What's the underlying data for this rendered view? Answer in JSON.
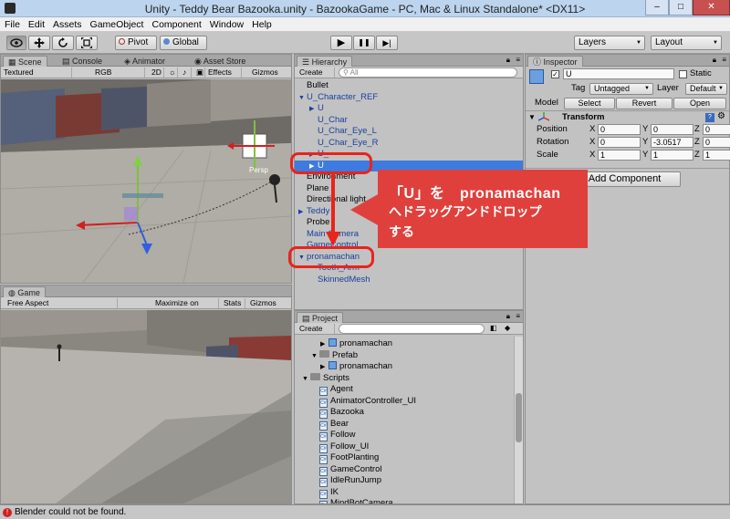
{
  "window": {
    "title": "Unity - Teddy Bear Bazooka.unity - BazookaGame - PC, Mac & Linux Standalone* <DX11>",
    "minimize": "–",
    "maximize": "□",
    "close": "✕"
  },
  "menu": [
    "File",
    "Edit",
    "Assets",
    "GameObject",
    "Component",
    "Window",
    "Help"
  ],
  "toolbar": {
    "pivot": "Pivot",
    "global": "Global",
    "layers": "Layers",
    "layout": "Layout",
    "play": "▶",
    "pause": "❚❚",
    "step": "▶|"
  },
  "scene": {
    "tabs": [
      "Scene",
      "Console",
      "Animator",
      "Asset Store"
    ],
    "strip": {
      "shading": "Textured",
      "render": "RGB",
      "mode2d": "2D",
      "effects": "Effects",
      "gizmos": "Gizmos",
      "search": "All"
    },
    "persp_label": "Persp"
  },
  "game": {
    "tab": "Game",
    "aspect": "Free Aspect",
    "maximize": "Maximize on Play",
    "stats": "Stats",
    "gizmos": "Gizmos"
  },
  "hierarchy": {
    "tab": "Hierarchy",
    "create": "Create",
    "search": "All",
    "items": [
      {
        "label": "Bullet",
        "indent": 0,
        "arrow": "",
        "color": "black"
      },
      {
        "label": "U_Character_REF",
        "indent": 0,
        "arrow": "▼",
        "color": "blue"
      },
      {
        "label": "U",
        "indent": 1,
        "arrow": "▶",
        "color": "blue"
      },
      {
        "label": "U_Char",
        "indent": 1,
        "arrow": "",
        "color": "blue"
      },
      {
        "label": "U_Char_Eye_L",
        "indent": 1,
        "arrow": "",
        "color": "blue"
      },
      {
        "label": "U_Char_Eye_R",
        "indent": 1,
        "arrow": "",
        "color": "blue"
      },
      {
        "label": "U_",
        "indent": 1,
        "arrow": "▶",
        "color": "blue"
      },
      {
        "label": "U",
        "indent": 1,
        "arrow": "▶",
        "color": "selected"
      },
      {
        "label": "Environment",
        "indent": 0,
        "arrow": "",
        "color": "black"
      },
      {
        "label": "Plane",
        "indent": 0,
        "arrow": "",
        "color": "black"
      },
      {
        "label": "Directional light",
        "indent": 0,
        "arrow": "",
        "color": "black"
      },
      {
        "label": "Teddy",
        "indent": 0,
        "arrow": "▶",
        "color": "blue"
      },
      {
        "label": "Probe",
        "indent": 0,
        "arrow": "",
        "color": "black"
      },
      {
        "label": "Main Camera",
        "indent": 0,
        "arrow": "",
        "color": "blue"
      },
      {
        "label": "GameControl",
        "indent": 0,
        "arrow": "",
        "color": "blue"
      },
      {
        "label": "pronamachan",
        "indent": 0,
        "arrow": "▼",
        "color": "blue"
      },
      {
        "label": "Tooth_Arm",
        "indent": 1,
        "arrow": "",
        "color": "blue"
      },
      {
        "label": "SkinnedMesh",
        "indent": 1,
        "arrow": "",
        "color": "blue"
      }
    ]
  },
  "project": {
    "tab": "Project",
    "create": "Create",
    "items": [
      {
        "label": "pronamachan",
        "kind": "prefab",
        "indent": 2
      },
      {
        "label": "Prefab",
        "kind": "folder",
        "indent": 1
      },
      {
        "label": "pronamachan",
        "kind": "prefab",
        "indent": 2
      },
      {
        "label": "Scripts",
        "kind": "folder",
        "indent": 0
      },
      {
        "label": "Agent",
        "kind": "script",
        "indent": 1
      },
      {
        "label": "AnimatorController_UI",
        "kind": "script",
        "indent": 1
      },
      {
        "label": "Bazooka",
        "kind": "script",
        "indent": 1
      },
      {
        "label": "Bear",
        "kind": "script",
        "indent": 1
      },
      {
        "label": "Follow",
        "kind": "script",
        "indent": 1
      },
      {
        "label": "Follow_UI",
        "kind": "script",
        "indent": 1
      },
      {
        "label": "FootPlanting",
        "kind": "script",
        "indent": 1
      },
      {
        "label": "GameControl",
        "kind": "script",
        "indent": 1
      },
      {
        "label": "IdleRunJump",
        "kind": "script",
        "indent": 1
      },
      {
        "label": "IK",
        "kind": "script",
        "indent": 1
      },
      {
        "label": "MindBotCamera",
        "kind": "script",
        "indent": 1
      }
    ]
  },
  "inspector": {
    "tab": "Inspector",
    "name": "U",
    "static": "Static",
    "tag_label": "Tag",
    "tag": "Untagged",
    "layer_label": "Layer",
    "layer": "Default",
    "model_label": "Model",
    "select": "Select",
    "revert": "Revert",
    "open": "Open",
    "transform": "Transform",
    "rows": [
      {
        "label": "Position",
        "x": "0",
        "y": "0",
        "z": "0"
      },
      {
        "label": "Rotation",
        "x": "0",
        "y": "-3.0517",
        "z": "0"
      },
      {
        "label": "Scale",
        "x": "1",
        "y": "1",
        "z": "1"
      }
    ],
    "add_component": "Add Component"
  },
  "callout": {
    "line1": "「U」を　pronamachan",
    "line2": "へドラッグアンドドロップ",
    "line3": "する"
  },
  "status": {
    "message": "Blender could not be found."
  },
  "colors": {
    "callout": "#e0403c",
    "ring": "#e8241c",
    "selection": "#3d7be0",
    "link": "#1a3f9e"
  }
}
